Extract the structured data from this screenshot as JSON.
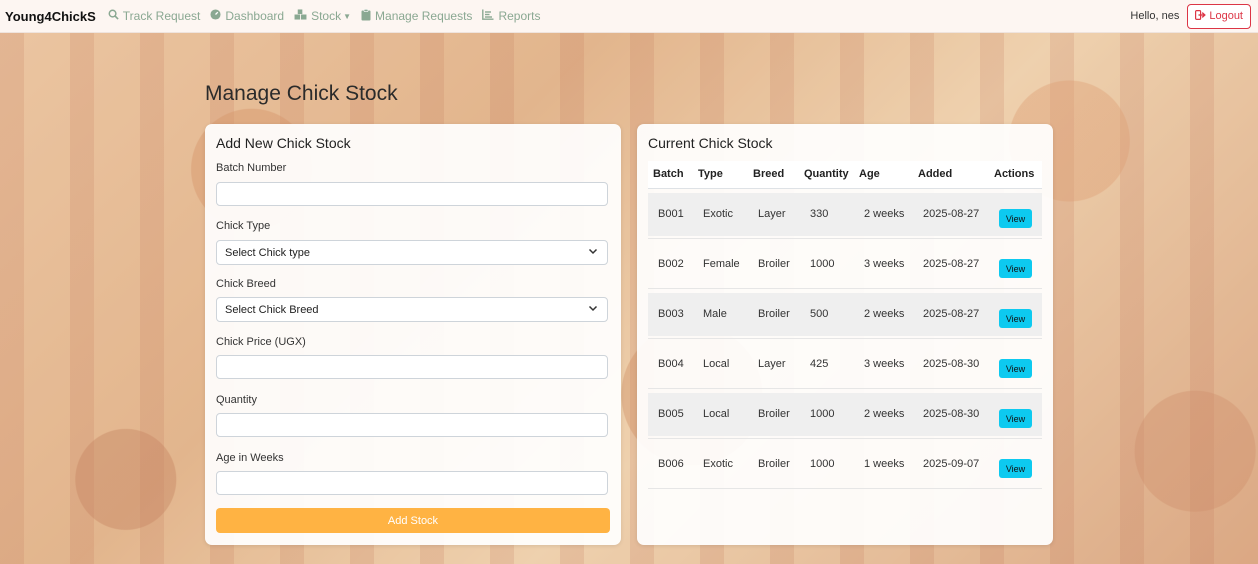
{
  "navbar": {
    "brand": "Young4ChickS",
    "items": [
      {
        "label": "Track Request",
        "icon": "search-icon"
      },
      {
        "label": "Dashboard",
        "icon": "dashboard-icon"
      },
      {
        "label": "Stock",
        "icon": "boxes-icon"
      },
      {
        "label": "Manage Requests",
        "icon": "clipboard-icon"
      },
      {
        "label": "Reports",
        "icon": "chart-icon"
      }
    ],
    "greeting": "Hello, nes",
    "logout_label": "Logout"
  },
  "page": {
    "title": "Manage Chick Stock"
  },
  "form": {
    "title": "Add New Chick Stock",
    "batch_label": "Batch Number",
    "batch_value": "",
    "type_label": "Chick Type",
    "type_selected": "Select Chick type",
    "breed_label": "Chick Breed",
    "breed_selected": "Select Chick Breed",
    "price_label": "Chick Price (UGX)",
    "price_value": "",
    "quantity_label": "Quantity",
    "quantity_value": "",
    "age_label": "Age in Weeks",
    "age_value": "",
    "submit_label": "Add Stock"
  },
  "stock": {
    "title": "Current Chick Stock",
    "headers": [
      "Batch",
      "Type",
      "Breed",
      "Quantity",
      "Age",
      "Added",
      "Actions"
    ],
    "view_label": "View",
    "rows": [
      {
        "batch": "B001",
        "type": "Exotic",
        "breed": "Layer",
        "quantity": "330",
        "age": "2 weeks",
        "added": "2025-08-27"
      },
      {
        "batch": "B002",
        "type": "Female",
        "breed": "Broiler",
        "quantity": "1000",
        "age": "3 weeks",
        "added": "2025-08-27"
      },
      {
        "batch": "B003",
        "type": "Male",
        "breed": "Broiler",
        "quantity": "500",
        "age": "2 weeks",
        "added": "2025-08-27"
      },
      {
        "batch": "B004",
        "type": "Local",
        "breed": "Layer",
        "quantity": "425",
        "age": "3 weeks",
        "added": "2025-08-30"
      },
      {
        "batch": "B005",
        "type": "Local",
        "breed": "Broiler",
        "quantity": "1000",
        "age": "2 weeks",
        "added": "2025-08-30"
      },
      {
        "batch": "B006",
        "type": "Exotic",
        "breed": "Broiler",
        "quantity": "1000",
        "age": "1 weeks",
        "added": "2025-09-07"
      }
    ]
  },
  "colors": {
    "brand_orange": "#ffb343",
    "view_cyan": "#0dcaf0",
    "logout_red": "#dc3545",
    "nav_text": "#8aa892"
  }
}
